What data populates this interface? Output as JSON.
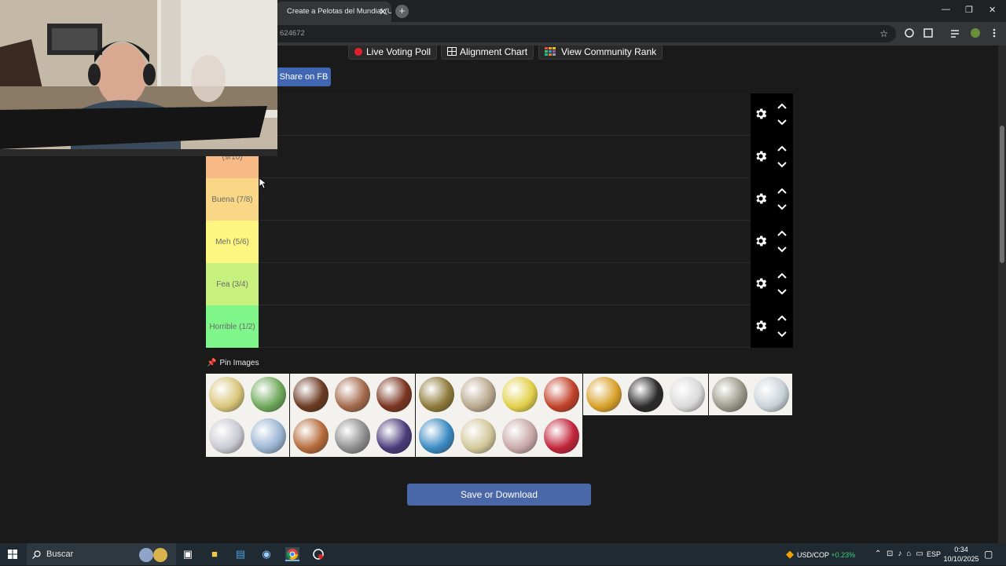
{
  "browser": {
    "tab_title": "Create a Pelotas del Mundial (U",
    "tab_close": "✕",
    "new_tab": "+",
    "url_text": "624672",
    "bookmark_star": "☆",
    "window_controls": {
      "minimize": "—",
      "restore": "❐",
      "close": "✕"
    }
  },
  "page": {
    "top_buttons": {
      "live_voting": "Live Voting Poll",
      "alignment_chart": "Alignment Chart",
      "community_rank": "View Community Rank"
    },
    "share_fb": "Share on FB",
    "tiers": [
      {
        "label": "",
        "color": "#1c1c1c"
      },
      {
        "label": "(9/10)",
        "color": "#f7b985"
      },
      {
        "label": "Buena (7/8)",
        "color": "#f9d786"
      },
      {
        "label": "Meh (5/6)",
        "color": "#fdf681"
      },
      {
        "label": "Fea (3/4)",
        "color": "#c8f07f"
      },
      {
        "label": "Horrible (1/2)",
        "color": "#80f58a"
      }
    ],
    "pin_images_label": "Pin Images",
    "save_button": "Save or Download",
    "pool_balls": [
      {
        "icon": "ball-2002-icon",
        "color": "#d9c57a"
      },
      {
        "icon": "ball-brazuca-icon",
        "color": "#6da85a"
      },
      {
        "icon": "ball-vintage-icon",
        "color": "#6b3a22"
      },
      {
        "icon": "ball-vintage-icon",
        "color": "#a36a4c"
      },
      {
        "icon": "ball-cote-du-monde-icon",
        "color": "#7a3520"
      },
      {
        "icon": "ball-swiss-icon",
        "color": "#8e7a3a"
      },
      {
        "icon": "ball-superball-icon",
        "color": "#b9a88e"
      },
      {
        "icon": "ball-top-star-icon",
        "color": "#e2d14a"
      },
      {
        "icon": "ball-challenge-icon",
        "color": "#c2412a"
      },
      {
        "icon": "ball-crack-icon",
        "color": "#d9a22a"
      },
      {
        "icon": "ball-telstar-icon",
        "color": "#2a2a2a"
      },
      {
        "icon": "ball-tango-icon",
        "color": "#d9d9d9"
      },
      {
        "icon": "ball-azteca-icon",
        "color": "#9a9a8a"
      },
      {
        "icon": "ball-etrusco-icon",
        "color": "#c9d2d8"
      },
      {
        "icon": "ball-questra-icon",
        "color": "#c9c9d2"
      },
      {
        "icon": "ball-fevernova-icon",
        "color": "#9ab4d2"
      },
      {
        "icon": "ball-tricolore-icon",
        "color": "#b56a3a"
      },
      {
        "icon": "ball-teamgeist-icon",
        "color": "#8e8e8e"
      },
      {
        "icon": "ball-telstar-18-icon",
        "color": "#4a3a7a"
      },
      {
        "icon": "ball-brazuca-icon",
        "color": "#3a8ac2"
      },
      {
        "icon": "ball-jabulani-icon",
        "color": "#d2c79a"
      },
      {
        "icon": "ball-al-rihla-icon",
        "color": "#c9a8a8"
      },
      {
        "icon": "ball-al-hilm-icon",
        "color": "#c2243a"
      }
    ]
  },
  "taskbar": {
    "search_placeholder": "Buscar",
    "currency": "USD/COP",
    "currency_change": "+0.23%",
    "language": "ESP",
    "time": "0:34",
    "date": "10/10/2025"
  }
}
